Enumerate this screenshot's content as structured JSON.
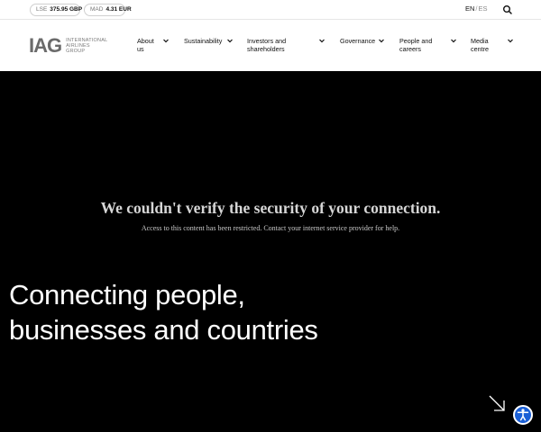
{
  "topbar": {
    "stocks": [
      {
        "exchange": "LSE",
        "value": "375.95 GBP"
      },
      {
        "exchange": "MAD",
        "value": "4.31 EUR"
      }
    ],
    "lang_active": "EN",
    "lang_sep": "/",
    "lang_other": "ES",
    "search_icon": "search-icon"
  },
  "header": {
    "logo_mark": "IAG",
    "logo_lines": [
      "INTERNATIONAL",
      "AIRLINES",
      "GROUP"
    ],
    "nav": [
      {
        "line1": "About",
        "line2": "us"
      },
      {
        "line1": "Sustainability",
        "line2": ""
      },
      {
        "line1": "Investors and",
        "line2": "shareholders"
      },
      {
        "line1": "Governance",
        "line2": ""
      },
      {
        "line1": "People and",
        "line2": "careers"
      },
      {
        "line1": "Media",
        "line2": "centre"
      }
    ],
    "chevron_icon": "chevron-down-icon"
  },
  "error": {
    "title": "We couldn't verify the security of your connection.",
    "message": "Access to this content has been restricted. Contact your internet service provider for help."
  },
  "hero": {
    "line1": "Connecting people,",
    "line2": "businesses and countries"
  },
  "icons": {
    "arrow": "arrow-down-right-icon",
    "accessibility": "accessibility-icon"
  },
  "colors": {
    "background": "#000000",
    "header": "#ffffff",
    "accessibility_button": "#1a5fd6"
  }
}
